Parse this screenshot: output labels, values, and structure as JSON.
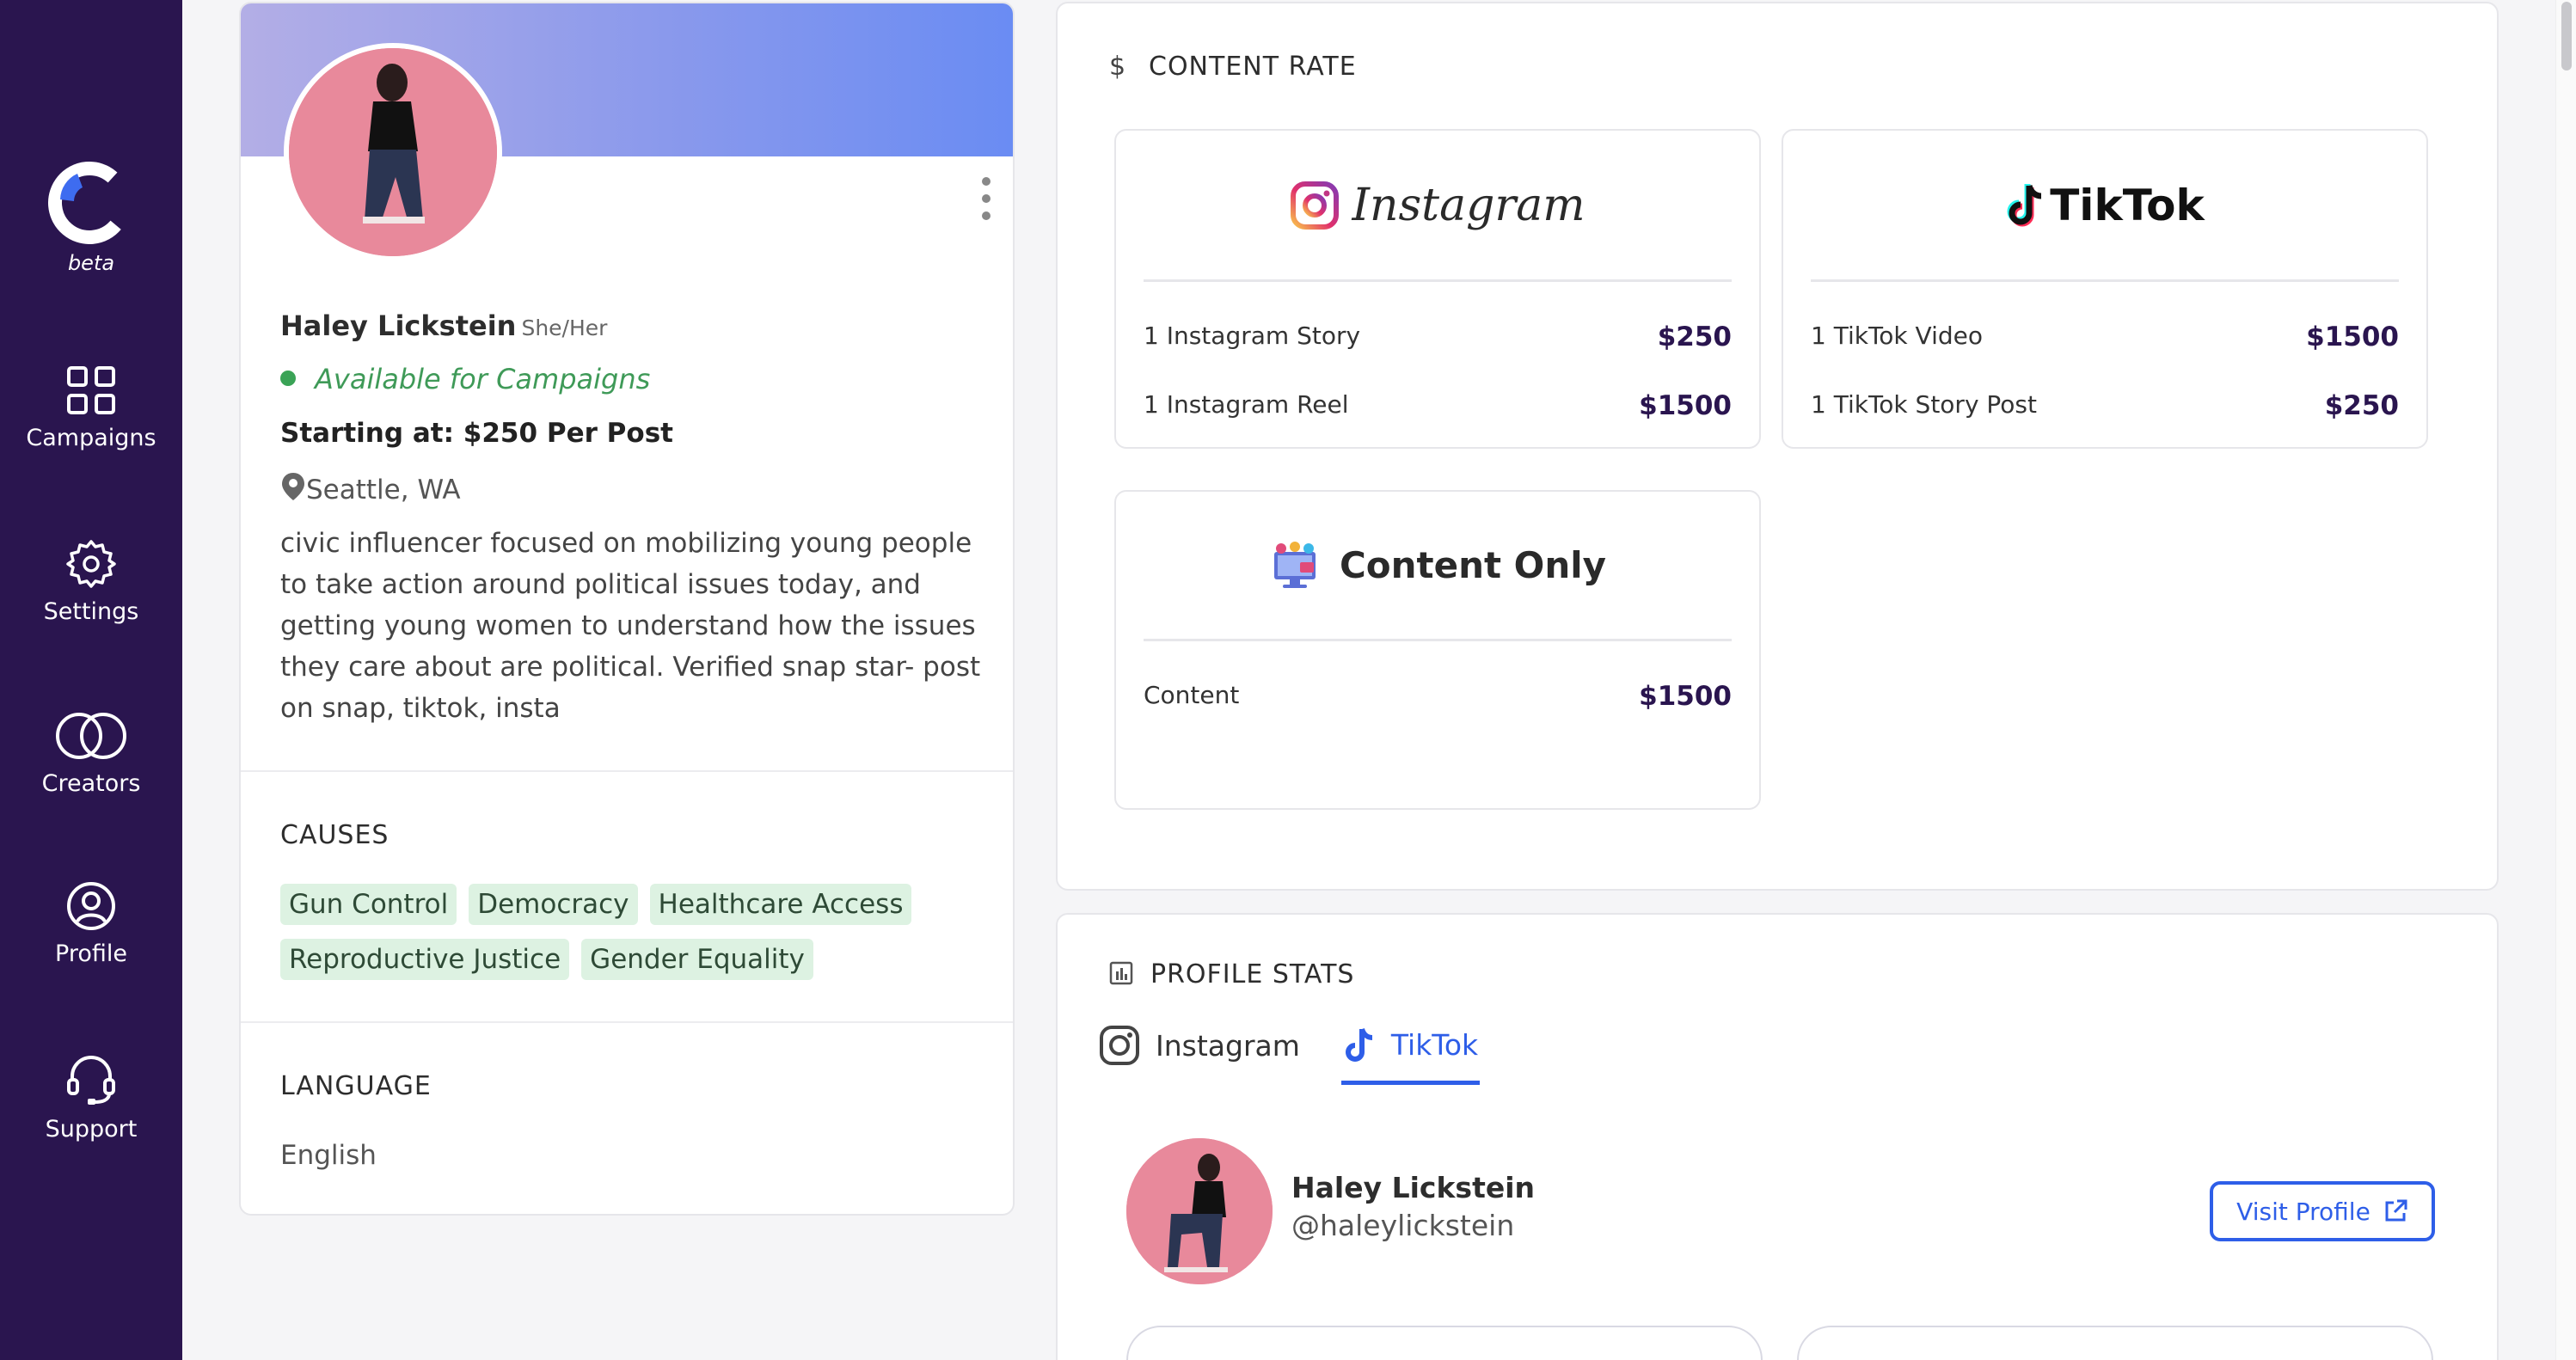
{
  "sidebar": {
    "beta_label": "beta",
    "items": [
      {
        "label": "Campaigns",
        "icon": "grid-icon"
      },
      {
        "label": "Settings",
        "icon": "gear-icon"
      },
      {
        "label": "Creators",
        "icon": "overlap-circles-icon"
      },
      {
        "label": "Profile",
        "icon": "user-circle-icon"
      },
      {
        "label": "Support",
        "icon": "headset-icon"
      }
    ]
  },
  "profile": {
    "name": "Haley Lickstein",
    "pronouns": "She/Her",
    "availability": "Available for Campaigns",
    "starting_at": "Starting at: $250 Per Post",
    "location": "Seattle, WA",
    "bio": "civic influencer focused on mobilizing young people to take action around political issues today, and getting young women to understand how the issues they care about are political. Verified snap star- post on snap, tiktok, insta",
    "causes_title": "CAUSES",
    "causes": [
      "Gun Control",
      "Democracy",
      "Healthcare Access",
      "Reproductive Justice",
      "Gender Equality"
    ],
    "language_title": "LANGUAGE",
    "language": "English"
  },
  "content_rate": {
    "heading_icon": "$",
    "heading": "CONTENT RATE",
    "instagram": {
      "brand": "Instagram",
      "rows": [
        {
          "label": "1 Instagram Story",
          "price": "$250"
        },
        {
          "label": "1 Instagram Reel",
          "price": "$1500"
        }
      ]
    },
    "tiktok": {
      "brand": "TikTok",
      "rows": [
        {
          "label": "1 TikTok Video",
          "price": "$1500"
        },
        {
          "label": "1 TikTok Story Post",
          "price": "$250"
        }
      ]
    },
    "content_only": {
      "brand": "Content Only",
      "rows": [
        {
          "label": "Content",
          "price": "$1500"
        }
      ]
    }
  },
  "profile_stats": {
    "heading": "PROFILE STATS",
    "tabs": [
      {
        "label": "Instagram",
        "active": false
      },
      {
        "label": "TikTok",
        "active": true
      }
    ],
    "account_name": "Haley Lickstein",
    "account_handle": "@haleylickstein",
    "visit_button": "Visit Profile"
  },
  "colors": {
    "sidebar_bg": "#2a154f",
    "accent_blue": "#2e5ee8",
    "available_green": "#3f9a58",
    "tag_bg": "#ddf2e2",
    "price_color": "#2a154f"
  }
}
